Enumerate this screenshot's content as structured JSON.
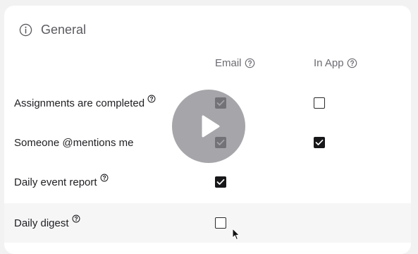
{
  "section": {
    "title": "General",
    "icon": "info-icon"
  },
  "columns": [
    {
      "label": "Email",
      "help_icon": "help-icon"
    },
    {
      "label": "In App",
      "help_icon": "help-icon"
    }
  ],
  "rows": [
    {
      "label": "Assignments are completed",
      "has_help": true,
      "email": true,
      "in_app": false
    },
    {
      "label": "Someone @mentions me",
      "has_help": false,
      "email": true,
      "in_app": true
    },
    {
      "label": "Daily event report",
      "has_help": true,
      "email": true,
      "in_app": null
    },
    {
      "label": "Daily digest",
      "has_help": true,
      "email": false,
      "in_app": null
    }
  ],
  "overlay": {
    "icon": "play-icon"
  },
  "colors": {
    "checked": "#17171a",
    "overlay": "#8c8c92",
    "row_highlight": "#f6f6f7"
  }
}
